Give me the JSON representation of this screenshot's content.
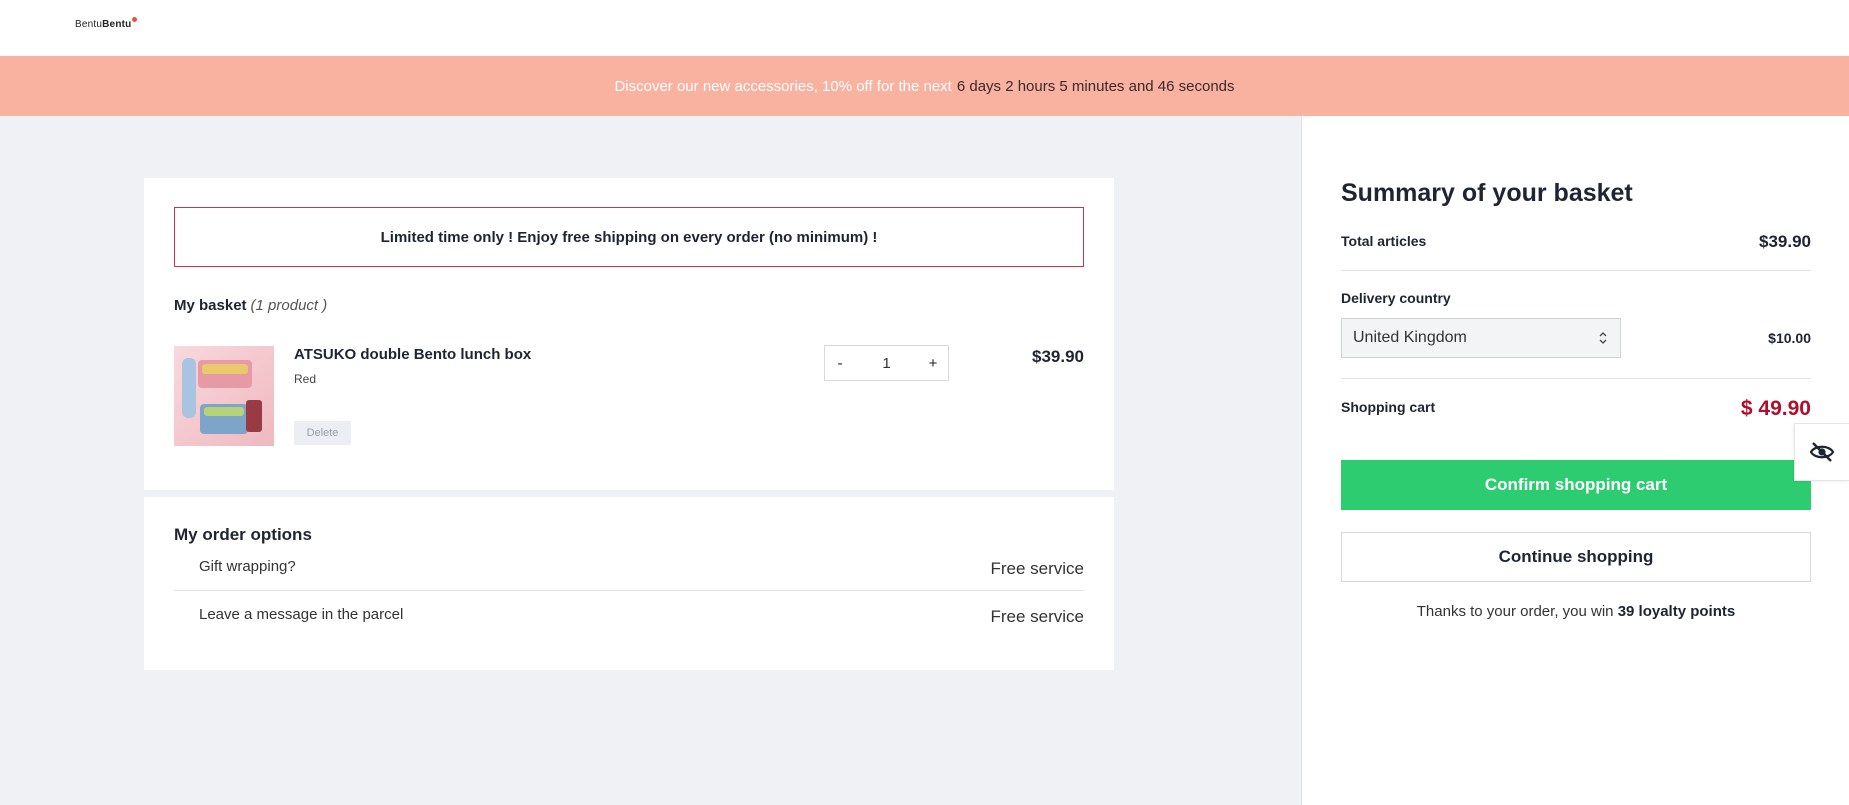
{
  "header": {
    "logo_text_light": "Bentu",
    "logo_text_bold": "Bentu"
  },
  "promo": {
    "lead": "Discover our new accessories, 10% off for the next",
    "countdown": "6 days 2 hours 5 minutes and 46 seconds"
  },
  "basket": {
    "notice": "Limited time only ! Enjoy free shipping on every order  (no minimum) !",
    "heading": "My basket",
    "count": "(1 product )",
    "item": {
      "name": "ATSUKO double Bento lunch box",
      "variant": "Red",
      "delete_label": "Delete",
      "qty_minus": "-",
      "qty_value": "1",
      "qty_plus": "+",
      "price": "$39.90"
    }
  },
  "options": {
    "title": "My order options",
    "rows": [
      {
        "label": "Gift wrapping?",
        "value": "Free service"
      },
      {
        "label": "Leave a message in the parcel",
        "value": "Free service"
      }
    ]
  },
  "summary": {
    "title": "Summary of your basket",
    "total_articles_label": "Total articles",
    "total_articles_value": "$39.90",
    "delivery_label": "Delivery country",
    "delivery_country": "United Kingdom",
    "delivery_price": "$10.00",
    "cart_label": "Shopping cart",
    "cart_value": "$ 49.90",
    "confirm_label": "Confirm shopping cart",
    "continue_label": "Continue shopping",
    "loyalty_text": "Thanks to your order, you win",
    "loyalty_points": "39 loyalty points"
  },
  "colors": {
    "promo_bg": "#f9b1a0",
    "confirm_green": "#2ecc71",
    "price_red": "#b10e2b",
    "notice_border": "#c8334f"
  },
  "icons": {
    "logo_dot": "logo-dot-icon",
    "select_chevron": "chevron-up-down-icon",
    "accessibility": "eye-slash-icon"
  }
}
